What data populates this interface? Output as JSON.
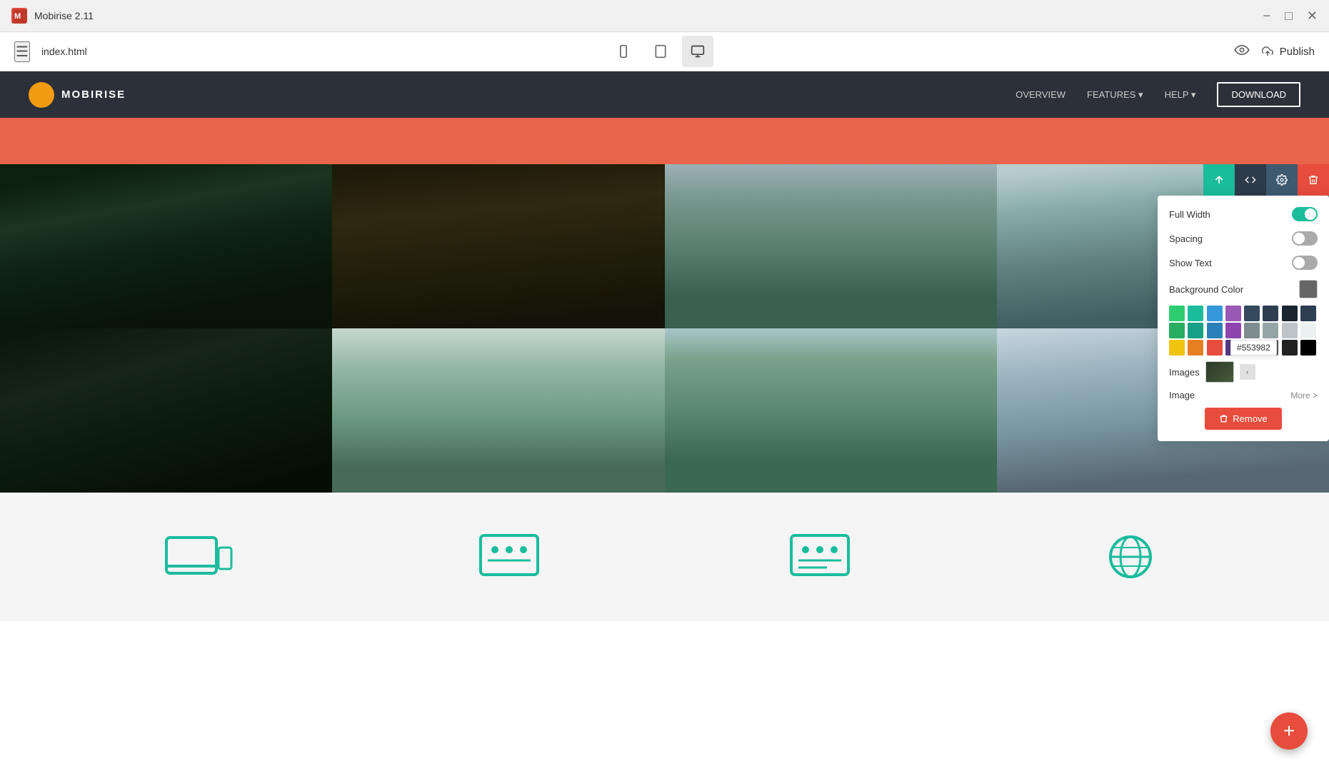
{
  "titlebar": {
    "logo_text": "M:",
    "title": "Mobirise 2.11",
    "minimize_label": "−",
    "maximize_label": "□",
    "close_label": "✕"
  },
  "toolbar": {
    "menu_icon": "☰",
    "filename": "index.html",
    "device_mobile_label": "mobile",
    "device_tablet_label": "tablet",
    "device_desktop_label": "desktop",
    "preview_label": "preview",
    "publish_label": "Publish",
    "upload_icon": "upload"
  },
  "site_navbar": {
    "logo_text": "MOBIRISE",
    "nav_items": [
      "OVERVIEW",
      "FEATURES ▾",
      "HELP ▾"
    ],
    "download_label": "DOWNLOAD"
  },
  "settings_panel": {
    "full_width_label": "Full Width",
    "full_width_value": true,
    "spacing_label": "Spacing",
    "spacing_value": false,
    "show_text_label": "Show Text",
    "show_text_value": false,
    "background_color_label": "Background Color",
    "images_label": "Images",
    "image_label": "Image",
    "more_label": "More >",
    "remove_label": "Remove",
    "hex_value": "#553982",
    "color_palette": [
      "#2ecc71",
      "#1abc9c",
      "#3498db",
      "#9b59b6",
      "#2c3e50",
      "#27ae60",
      "#16a085",
      "#2980b9",
      "#8e44ad",
      "#34495e",
      "#f1c40f",
      "#e67e22",
      "#e74c3c",
      "#95a5a6",
      "#7f8c8d",
      "#f39c12",
      "#d35400",
      "#c0392b",
      "#bdc3c7",
      "#2c2c2c"
    ]
  },
  "block_toolbar": {
    "sort_icon": "↕",
    "code_icon": "</>",
    "gear_icon": "⚙",
    "delete_icon": "🗑"
  },
  "gallery": {
    "images": [
      {
        "alt": "forest sunbeam",
        "class": "img-forest-sunbeam"
      },
      {
        "alt": "forest path",
        "class": "img-forest-path"
      },
      {
        "alt": "misty hills",
        "class": "img-misty-hills"
      },
      {
        "alt": "forest fog right",
        "class": "img-forest-fog-right"
      },
      {
        "alt": "dense forest",
        "class": "img-dense-forest"
      },
      {
        "alt": "bamboo fog",
        "class": "img-bamboo-fog"
      },
      {
        "alt": "mountain road",
        "class": "img-mountain-road"
      },
      {
        "alt": "forest mist",
        "class": "img-forest-mist"
      }
    ]
  },
  "fab": {
    "label": "+"
  }
}
